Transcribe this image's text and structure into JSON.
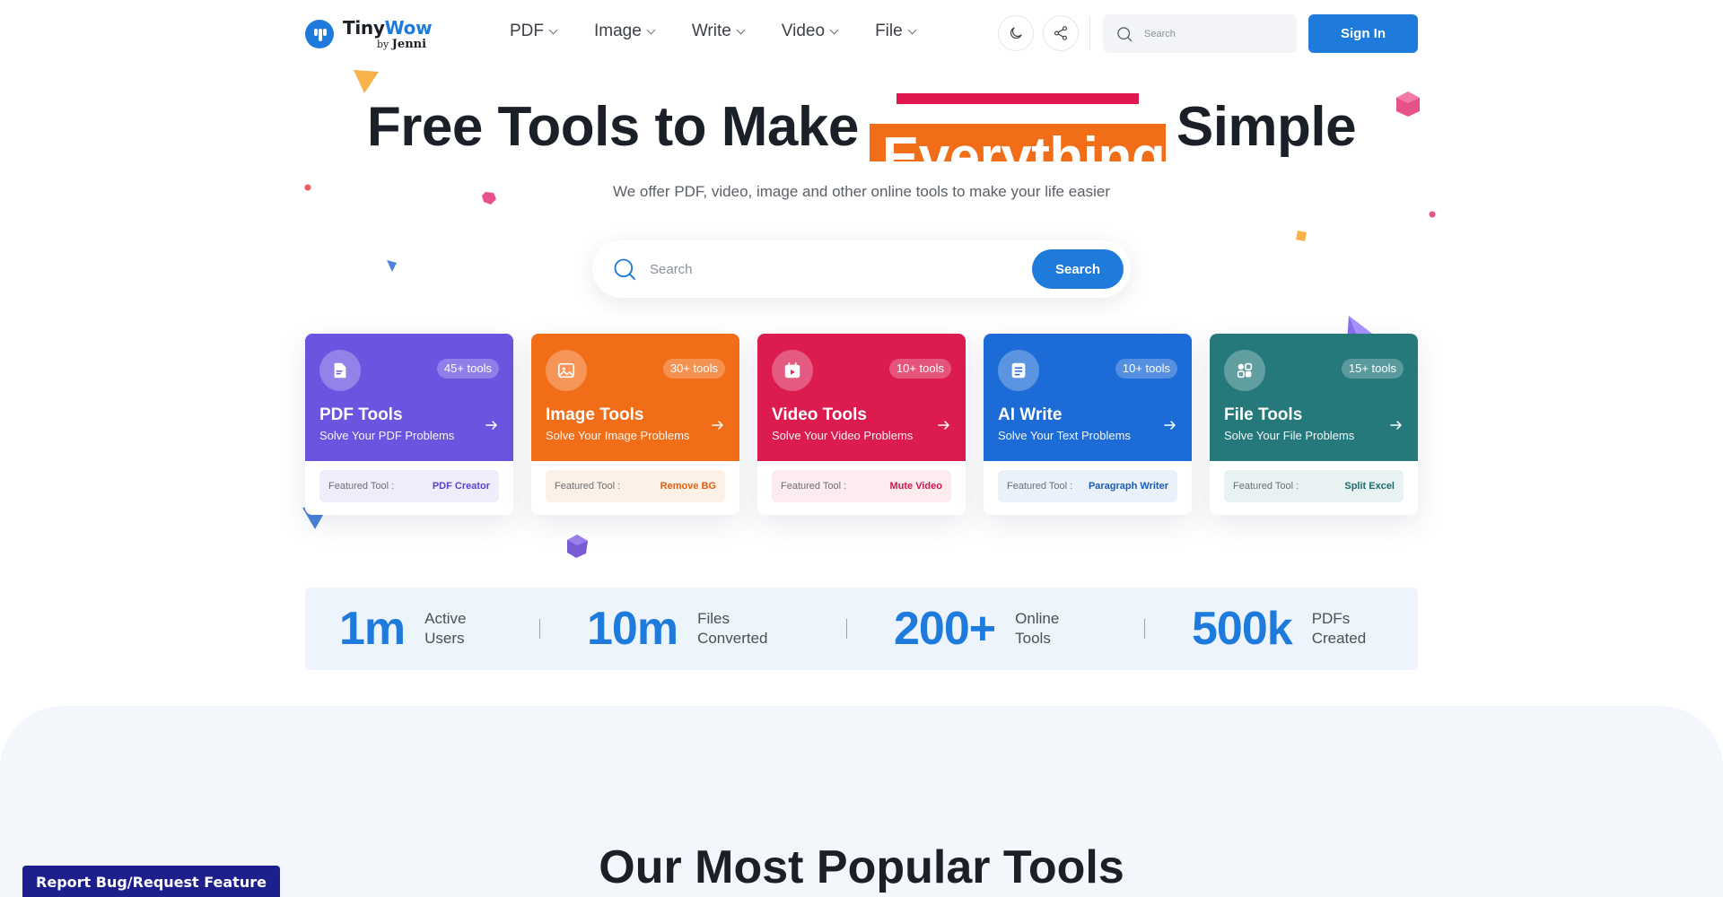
{
  "header": {
    "logo": {
      "brand_a": "Tiny",
      "brand_b": "Wow",
      "by": "by",
      "byline": "Jenni"
    },
    "nav": [
      {
        "label": "PDF"
      },
      {
        "label": "Image"
      },
      {
        "label": "Write"
      },
      {
        "label": "Video"
      },
      {
        "label": "File"
      }
    ],
    "search_placeholder": "Search",
    "signin_label": "Sign In",
    "icons": [
      "moon-icon",
      "share-icon",
      "search-icon"
    ]
  },
  "hero": {
    "title_before": "Free Tools to Make",
    "title_highlight": "Everything",
    "title_after": "Simple",
    "subtitle": "We offer PDF, video, image and other online tools to make your life easier",
    "search_placeholder": "Search",
    "search_button": "Search",
    "highlight_bar_color": "#e0174f",
    "highlight_box_color": "#f26d17"
  },
  "cards": [
    {
      "title": "PDF Tools",
      "subtitle": "Solve Your PDF Problems",
      "count": "45+ tools",
      "featured_label": "Featured Tool :",
      "featured_value": "PDF Creator",
      "color": "#6c53e0",
      "feat_bg": "#efedfb",
      "feat_color": "#5a43cf",
      "icon": "pdf-file-icon"
    },
    {
      "title": "Image Tools",
      "subtitle": "Solve Your Image Problems",
      "count": "30+ tools",
      "featured_label": "Featured Tool :",
      "featured_value": "Remove BG",
      "color": "#f26d17",
      "feat_bg": "#fdf0e7",
      "feat_color": "#e25f12",
      "icon": "image-icon"
    },
    {
      "title": "Video Tools",
      "subtitle": "Solve Your Video Problems",
      "count": "10+ tools",
      "featured_label": "Featured Tool :",
      "featured_value": "Mute Video",
      "color": "#dc1b4f",
      "feat_bg": "#fcebef",
      "feat_color": "#cf1749",
      "icon": "video-calendar-icon"
    },
    {
      "title": "AI Write",
      "subtitle": "Solve Your Text Problems",
      "count": "10+ tools",
      "featured_label": "Featured Tool :",
      "featured_value": "Paragraph Writer",
      "color": "#1d6bd6",
      "feat_bg": "#eaf1fb",
      "feat_color": "#1a5bb8",
      "icon": "document-text-icon"
    },
    {
      "title": "File Tools",
      "subtitle": "Solve Your File Problems",
      "count": "15+ tools",
      "featured_label": "Featured Tool :",
      "featured_value": "Split Excel",
      "color": "#25797b",
      "feat_bg": "#e8f2f2",
      "feat_color": "#1f6a6c",
      "icon": "file-shapes-icon"
    }
  ],
  "stats": [
    {
      "value": "1m",
      "label_1": "Active",
      "label_2": "Users"
    },
    {
      "value": "10m",
      "label_1": "Files",
      "label_2": "Converted"
    },
    {
      "value": "200+",
      "label_1": "Online",
      "label_2": "Tools"
    },
    {
      "value": "500k",
      "label_1": "PDFs",
      "label_2": "Created"
    }
  ],
  "popular_title": "Our Most Popular Tools",
  "report_label": "Report Bug/Request Feature",
  "accent": "#1e7bdc"
}
